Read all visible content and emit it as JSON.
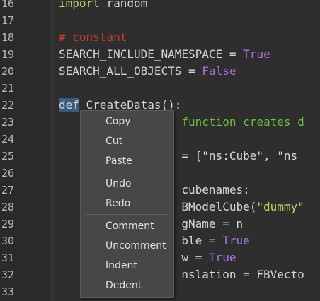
{
  "lines": [
    {
      "num": "16",
      "segments": [
        {
          "t": "import ",
          "c": "c-str"
        },
        {
          "t": "random",
          "c": "c-plain"
        }
      ]
    },
    {
      "num": "17",
      "segments": []
    },
    {
      "num": "18",
      "segments": [
        {
          "t": "# constant",
          "c": "c-comment"
        }
      ]
    },
    {
      "num": "19",
      "segments": [
        {
          "t": "SEARCH_INCLUDE_NAMESPACE = ",
          "c": "c-plain"
        },
        {
          "t": "True",
          "c": "c-bool"
        }
      ]
    },
    {
      "num": "20",
      "segments": [
        {
          "t": "SEARCH_ALL_OBJECTS = ",
          "c": "c-plain"
        },
        {
          "t": "False",
          "c": "c-bool"
        }
      ]
    },
    {
      "num": "21",
      "segments": []
    },
    {
      "num": "22",
      "segments": [
        {
          "t": "def",
          "c": "kw-sel"
        },
        {
          "t": " CreateDatas():",
          "c": "c-plain"
        }
      ]
    },
    {
      "num": "23",
      "segments": [
        {
          "t": "                  function creates d",
          "c": "c-fncomment"
        }
      ]
    },
    {
      "num": "24",
      "segments": []
    },
    {
      "num": "25",
      "segments": [
        {
          "t": "                  = [\"ns:Cube\", \"ns",
          "c": "c-plain"
        }
      ]
    },
    {
      "num": "26",
      "segments": []
    },
    {
      "num": "27",
      "segments": [
        {
          "t": "                  cubenames:",
          "c": "c-plain"
        }
      ]
    },
    {
      "num": "28",
      "segments": [
        {
          "t": "                  BModelCube(",
          "c": "c-plain"
        },
        {
          "t": "\"dummy\"",
          "c": "c-str"
        }
      ]
    },
    {
      "num": "29",
      "segments": [
        {
          "t": "                  gName = n",
          "c": "c-plain"
        }
      ]
    },
    {
      "num": "30",
      "segments": [
        {
          "t": "                  ble = ",
          "c": "c-plain"
        },
        {
          "t": "True",
          "c": "c-bool"
        }
      ]
    },
    {
      "num": "31",
      "segments": [
        {
          "t": "                  w = ",
          "c": "c-plain"
        },
        {
          "t": "True",
          "c": "c-bool"
        }
      ]
    },
    {
      "num": "32",
      "segments": [
        {
          "t": "                  nslation = FBVecto",
          "c": "c-plain"
        }
      ]
    },
    {
      "num": "33",
      "segments": []
    }
  ],
  "context_menu": {
    "items": [
      {
        "label": "Copy",
        "name": "menu-item-copy"
      },
      {
        "label": "Cut",
        "name": "menu-item-cut"
      },
      {
        "label": "Paste",
        "name": "menu-item-paste"
      },
      {
        "label": "Undo",
        "name": "menu-item-undo"
      },
      {
        "label": "Redo",
        "name": "menu-item-redo"
      },
      {
        "label": "Comment",
        "name": "menu-item-comment"
      },
      {
        "label": "Uncomment",
        "name": "menu-item-uncomment"
      },
      {
        "label": "Indent",
        "name": "menu-item-indent"
      },
      {
        "label": "Dedent",
        "name": "menu-item-dedent"
      }
    ]
  },
  "colors": {
    "background": "#2e2e2e",
    "comment": "#d13b2c",
    "bool": "#a873d8",
    "string": "#cfcf6a",
    "docstring": "#6fbf3a",
    "selection": "#3c5a7a"
  }
}
